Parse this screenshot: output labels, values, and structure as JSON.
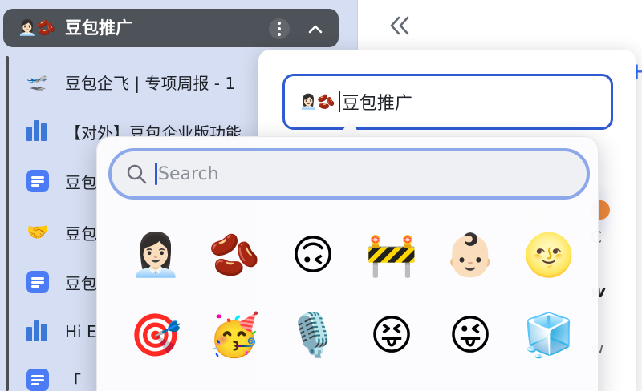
{
  "sidebar": {
    "space_title": "豆包推广",
    "space_emoji": "👩🏻‍💼🫘",
    "items": [
      {
        "icon": "airplane-icon",
        "glyph": "🛫",
        "label": "豆包企飞 | 专项周报 - 1"
      },
      {
        "icon": "sheet-icon",
        "glyph": "",
        "label": "【对外】豆包企业版功能"
      },
      {
        "icon": "doc-icon",
        "glyph": "",
        "label": "豆包"
      },
      {
        "icon": "handshake-icon",
        "glyph": "🤝",
        "label": "豆包"
      },
      {
        "icon": "doc-icon",
        "glyph": "",
        "label": "豆包"
      },
      {
        "icon": "sheet-icon",
        "glyph": "",
        "label": "Hi E"
      },
      {
        "icon": "doc-icon",
        "glyph": "",
        "label": "「"
      }
    ]
  },
  "title_editor": {
    "emoji": "👩🏻‍💼🫘",
    "value": "豆包推广"
  },
  "emoji_picker": {
    "search_placeholder": "Search",
    "emojis": [
      "👩🏻‍💼",
      "🫘",
      "🙃",
      "🚧",
      "👶🏻",
      "🌝",
      "🎯",
      "🥳",
      "🎙️",
      "😝",
      "😜",
      "🧊"
    ]
  },
  "background": {
    "peek_right": "H",
    "peek_texts": [
      "C",
      "w",
      "w"
    ]
  },
  "colors": {
    "sidebar_bg": "#d6def3",
    "header_bg": "#4e5259",
    "accent": "#2f5bd3",
    "doc_icon": "#4c7cf5"
  }
}
